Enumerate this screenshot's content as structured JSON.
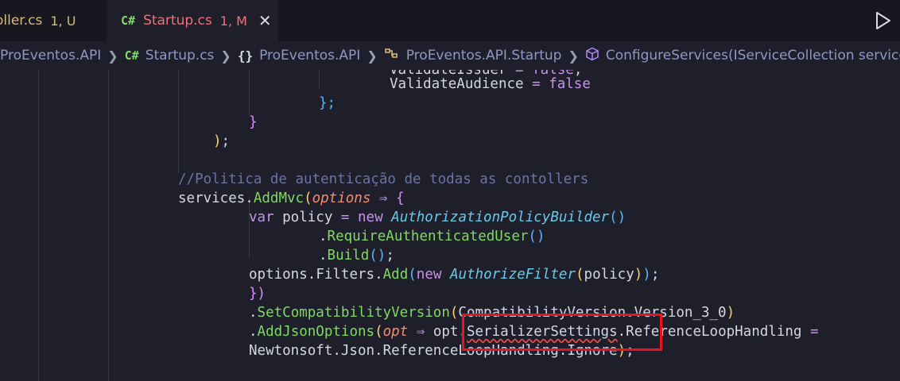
{
  "tabs": [
    {
      "icon": "",
      "filename": "oller.cs",
      "status": "1, U"
    },
    {
      "icon": "C#",
      "filename": "Startup.cs",
      "status": "1, M",
      "close": "✕"
    }
  ],
  "breadcrumb": [
    {
      "text": "ProEventos.API"
    },
    {
      "icon": "C#",
      "text": "Startup.cs"
    },
    {
      "icon": "{}",
      "text": "ProEventos.API"
    },
    {
      "icon": "class",
      "text": "ProEventos.API.Startup"
    },
    {
      "icon": "method",
      "text": "ConfigureServices(IServiceCollection services"
    }
  ],
  "code": {
    "l1": {
      "t1": "ValidateIssuer",
      "t2": " = ",
      "t3": "false",
      "t4": ";"
    },
    "l2": {
      "t1": "ValidateAudience",
      "t2": " = ",
      "t3": "false"
    },
    "l3": {
      "t1": "};"
    },
    "l4": {
      "t1": "}"
    },
    "l5": {
      "t1": ")",
      "t2": ";"
    },
    "l6": {
      "t1": "//Politica de autenticação de todas as contollers"
    },
    "l7": {
      "t1": "services",
      "t2": ".",
      "t3": "AddMvc",
      "t4": "(",
      "t5": "options",
      "t6": " ⇒ ",
      "t7": "{"
    },
    "l8": {
      "t1": "var",
      "t2": " policy ",
      "t3": "=",
      "t4": " ",
      "t5": "new",
      "t6": " ",
      "t7": "AuthorizationPolicyBuilder",
      "t8": "()"
    },
    "l9": {
      "t1": ".",
      "t2": "RequireAuthenticatedUser",
      "t3": "()"
    },
    "l10": {
      "t1": ".",
      "t2": "Build",
      "t3": "()",
      "t4": ";"
    },
    "l11": {
      "t1": "options",
      "t2": ".",
      "t3": "Filters",
      "t4": ".",
      "t5": "Add",
      "t6": "(",
      "t7": "new",
      "t8": " ",
      "t9": "AuthorizeFilter",
      "t10": "(",
      "t11": "policy",
      "t12": ")",
      "t13": ")",
      "t14": ";"
    },
    "l12": {
      "t1": "})"
    },
    "l13": {
      "t1": ".",
      "t2": "SetCompatibilityVersion",
      "t3": "(",
      "t4": "CompatibilityVersion.Version_3_0",
      "t5": ")"
    },
    "l14": {
      "t1": ".",
      "t2": "AddJsonOptions",
      "t3": "(",
      "t4": "opt",
      "t5": " ⇒ ",
      "t6": "opt.",
      "t7": "SerializerSettings",
      "t8": ".ReferenceLoopHandling ",
      "t9": "="
    },
    "l15": {
      "t1": "Newtonsoft.Json.ReferenceLoopHandling.Ignore",
      "t2": ")",
      "t3": ";"
    }
  },
  "colors": {
    "accent": "#e8141d",
    "background": "#1e1f2b"
  },
  "icons": [
    "csharp-file-icon",
    "close-icon",
    "run-icon",
    "chevron-right-icon",
    "namespace-icon",
    "class-icon",
    "method-icon"
  ]
}
